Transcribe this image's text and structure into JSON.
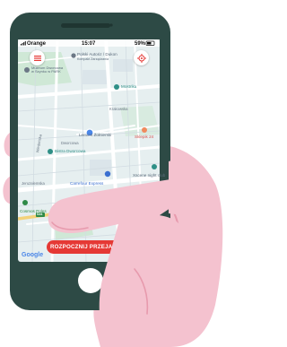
{
  "status_bar": {
    "carrier": "Orange",
    "time": "15:07",
    "battery": "59%"
  },
  "map": {
    "labels": {
      "top_location": "Polski Autoriz / Dukon",
      "top_location_sub": "Kompakt Zarządzania",
      "museum": "Muzeum Dworcowa w Szynku w PARK",
      "mostriku": "Mostriku",
      "lemont": "Lemont Żołnierski",
      "szkola": "Szkoła Wyższa Gumowska",
      "bistro": "Bistra Dworcowa",
      "sklepik": "Sklepik 24",
      "xscene": "Xscene night club",
      "carrefour": "Carrefour Express",
      "gym": "Gym Corner",
      "cosmos": "Cosmos Poles",
      "street_jeruzalem": "Jeruzalemska",
      "street_dworcowa": "Dworcowa",
      "street_wiedenska": "Wiedeńska",
      "street_krakowska": "Krakowska",
      "road_num": "S34"
    }
  },
  "start_button_label": "ROZPOCZNIJ PRZEJAZD",
  "google_logo": "Google",
  "icons": {
    "menu": "hamburger-icon",
    "location": "target-icon"
  },
  "colors": {
    "skin": "#f4c2cf",
    "skin_dark": "#e79aad",
    "phone": "#2d4a45",
    "map": "#e6eff0",
    "road": "#ffffff",
    "park": "#cfe8d6",
    "accent": "#e53935"
  }
}
